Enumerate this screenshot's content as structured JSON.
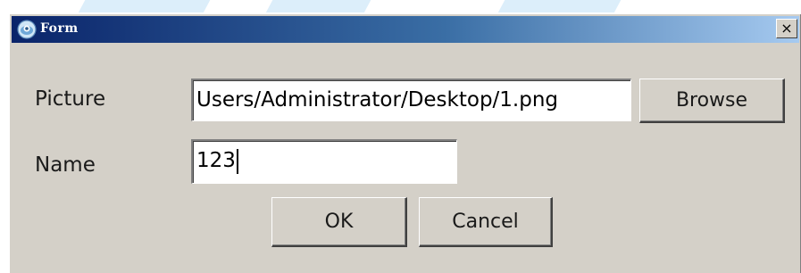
{
  "window": {
    "title": "Form",
    "close_label": "×"
  },
  "form": {
    "picture_label": "Picture",
    "picture_value": "Users/Administrator/Desktop/1.png",
    "browse_label": "Browse",
    "name_label": "Name",
    "name_value": "123",
    "ok_label": "OK",
    "cancel_label": "Cancel"
  },
  "colors": {
    "titlebar_start": "#0a246a",
    "titlebar_end": "#a6caf0",
    "window_face": "#d4d0c8",
    "field_background": "#ffffff"
  },
  "icons": {
    "title": "app-window-icon",
    "close": "close-icon"
  }
}
